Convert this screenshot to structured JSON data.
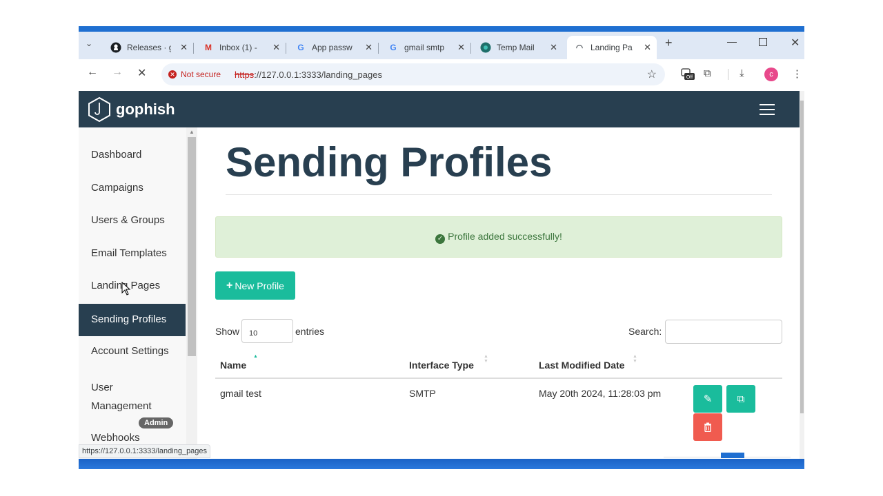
{
  "browser": {
    "tabs": [
      {
        "title": "Releases · g",
        "icon": "github-icon",
        "active": false
      },
      {
        "title": "Inbox (1) - ",
        "icon": "gmail-icon",
        "active": false
      },
      {
        "title": "App passw",
        "icon": "google-icon",
        "active": false
      },
      {
        "title": "gmail smtp",
        "icon": "google-icon",
        "active": false
      },
      {
        "title": "Temp Mail",
        "icon": "tempmail-icon",
        "active": false
      },
      {
        "title": "Landing Pa",
        "icon": "loading-icon",
        "active": true
      }
    ],
    "not_secure_label": "Not secure",
    "url_scheme": "https",
    "url_rest": "://127.0.0.1:3333/landing_pages",
    "profile_initial": "c",
    "extension_badge": "Off",
    "status_url": "https://127.0.0.1:3333/landing_pages"
  },
  "app": {
    "logo_text": "gophish",
    "sidebar": {
      "items": [
        {
          "label": "Dashboard"
        },
        {
          "label": "Campaigns"
        },
        {
          "label": "Users & Groups"
        },
        {
          "label": "Email Templates"
        },
        {
          "label": "Landing Pages"
        },
        {
          "label": "Sending Profiles",
          "active": true
        },
        {
          "label": "Account Settings"
        },
        {
          "label": "User Management"
        },
        {
          "label": "Webhooks"
        }
      ],
      "admin_badge": "Admin"
    },
    "page_title": "Sending Profiles",
    "alert_text": "Profile added successfully!",
    "new_profile_label": "New Profile",
    "table_controls": {
      "show_label": "Show",
      "entries_value": "10",
      "entries_label": "entries",
      "search_label": "Search:"
    },
    "table": {
      "headers": [
        "Name",
        "Interface Type",
        "Last Modified Date"
      ],
      "rows": [
        {
          "name": "gmail test",
          "interface_type": "SMTP",
          "last_modified": "May 20th 2024, 11:28:03 pm"
        }
      ]
    },
    "colors": {
      "navbar": "#283f50",
      "accent": "#1abc9c",
      "danger": "#f05b4f",
      "success_bg": "#dff0d8",
      "success_text": "#3c763d"
    }
  }
}
